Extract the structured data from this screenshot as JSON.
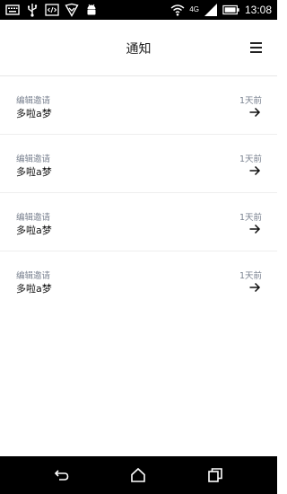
{
  "status_bar": {
    "time": "13:08",
    "network_label": "4G",
    "left_icons": [
      "keyboard-icon",
      "usb-icon",
      "code-icon",
      "shield-icon",
      "android-icon"
    ],
    "right_icons": [
      "wifi-icon",
      "signal-icon",
      "battery-icon"
    ]
  },
  "header": {
    "title": "通知",
    "menu_icon": "menu-icon"
  },
  "notifications": [
    {
      "type": "编辑邀请",
      "name": "多啦a梦",
      "time": "1天前"
    },
    {
      "type": "编辑邀请",
      "name": "多啦a梦",
      "time": "1天前"
    },
    {
      "type": "编辑邀请",
      "name": "多啦a梦",
      "time": "1天前"
    },
    {
      "type": "编辑邀请",
      "name": "多啦a梦",
      "time": "1天前"
    }
  ],
  "nav_bar": {
    "buttons": [
      "back-icon",
      "home-icon",
      "recents-icon"
    ]
  }
}
